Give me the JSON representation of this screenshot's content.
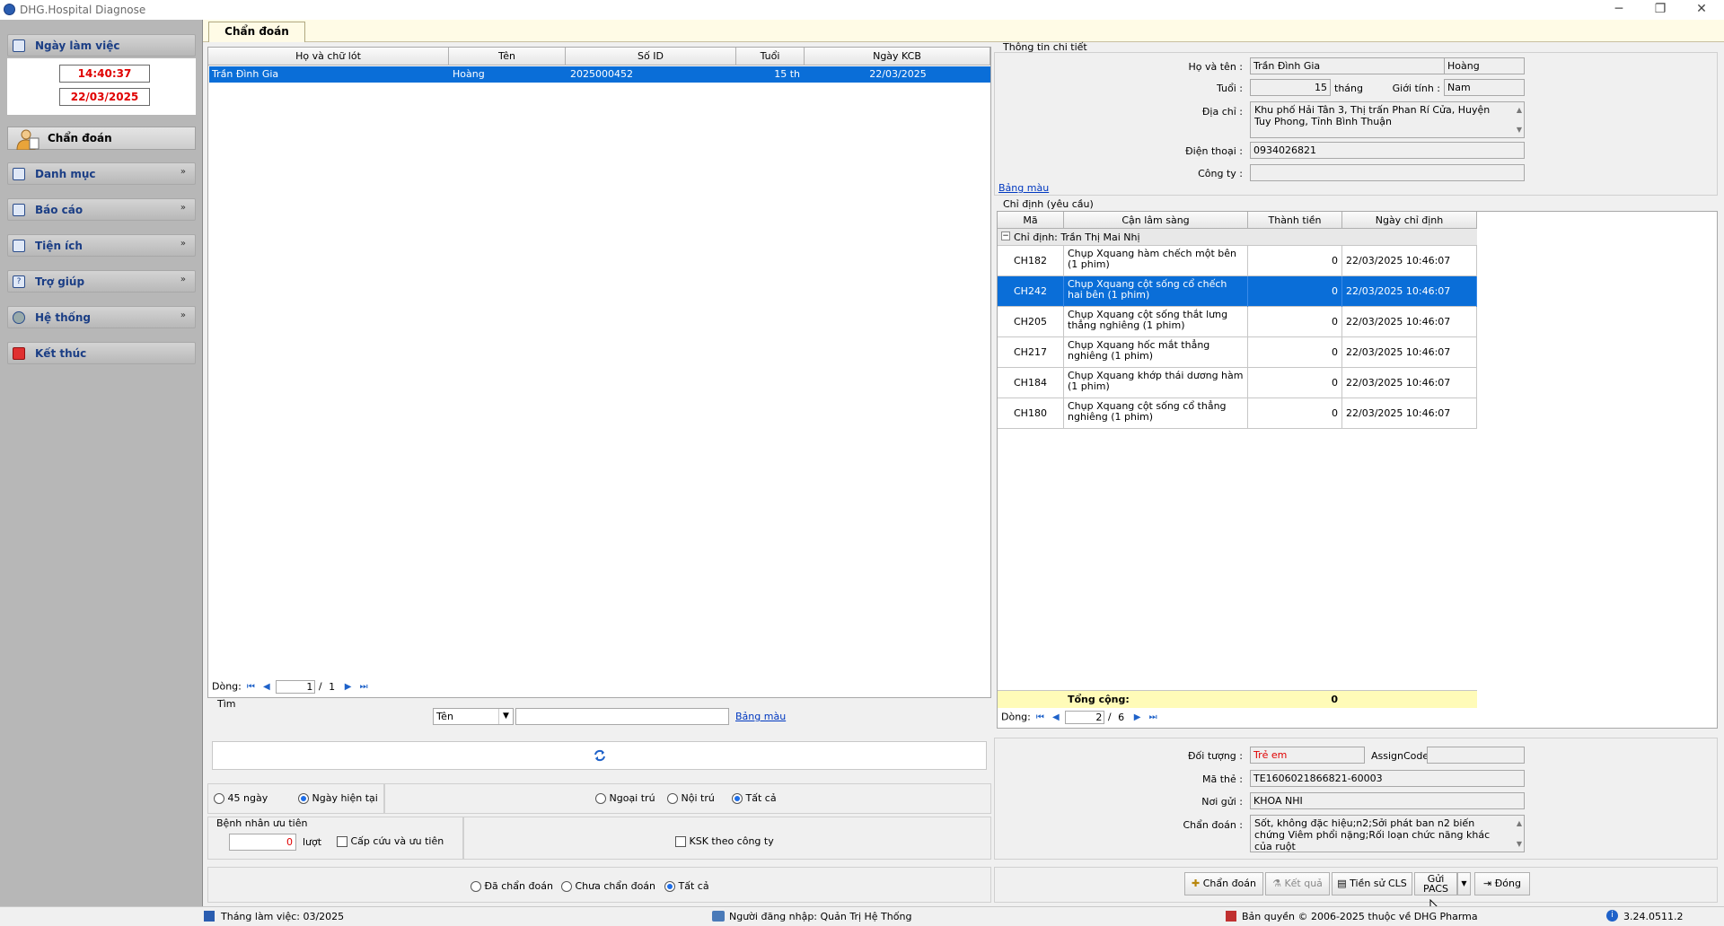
{
  "window": {
    "title": "DHG.Hospital Diagnose",
    "min": "─",
    "restore": "❐",
    "close": "✕"
  },
  "sidebar": {
    "work_day_label": "Ngày làm việc",
    "time": "14:40:37",
    "date": "22/03/2025",
    "active_item": "Chẩn đoán",
    "items": [
      {
        "label": "Danh mục",
        "chev": "»"
      },
      {
        "label": "Báo cáo",
        "chev": "»"
      },
      {
        "label": "Tiện ích",
        "chev": "»"
      },
      {
        "label": "Trợ giúp",
        "chev": "»"
      },
      {
        "label": "Hệ thống",
        "chev": "»"
      },
      {
        "label": "Kết thúc",
        "chev": ""
      }
    ]
  },
  "tab": {
    "label": "Chẩn đoán"
  },
  "patients": {
    "columns": [
      "Họ và chữ lót",
      "Tên",
      "Số ID",
      "Tuổi",
      "Ngày KCB"
    ],
    "rows": [
      [
        "Trần Đình Gia",
        "Hoàng",
        "2025000452",
        "15 th",
        "22/03/2025"
      ]
    ],
    "nav": {
      "label": "Dòng:",
      "page": "1",
      "sep": "/",
      "total": "1"
    }
  },
  "search": {
    "label": "Tìm",
    "field": "Tên",
    "value": "",
    "color_link": "Bảng màu"
  },
  "filters": {
    "days45": "45 ngày",
    "today": "Ngày hiện tại",
    "outpatient": "Ngoại trú",
    "inpatient": "Nội trú",
    "all": "Tất cả",
    "priority_group": "Bệnh nhân ưu tiên",
    "priority_count": "0",
    "visits": "lượt",
    "emergency": "Cấp cứu và ưu tiên",
    "ksk": "KSK theo công ty",
    "diagnosed": "Đã chẩn đoán",
    "not_diagnosed": "Chưa chẩn đoán",
    "all2": "Tất cả"
  },
  "detail": {
    "group_title": "Thông tin chi tiết",
    "name_label": "Họ và tên :",
    "surname": "Trần Đình Gia",
    "firstname": "Hoàng",
    "age_label": "Tuổi :",
    "age": "15",
    "age_unit": "tháng",
    "gender_label": "Giới tính :",
    "gender": "Nam",
    "address_label": "Địa chỉ :",
    "address": "Khu phố Hải Tân 3, Thị trấn Phan Rí Cửa, Huyện Tuy Phong, Tỉnh Bình Thuận",
    "phone_label": "Điện thoại :",
    "phone": "0934026821",
    "company_label": "Công ty :",
    "company": "",
    "color_link": "Bảng màu"
  },
  "orders": {
    "group_title": "Chỉ định (yêu cầu)",
    "columns": [
      "Mã",
      "Cận lâm sàng",
      "Thành tiền",
      "Ngày chỉ định"
    ],
    "group_row": "Chỉ định:  Trần Thị Mai Nhị",
    "rows": [
      {
        "code": "CH182",
        "name": "Chụp Xquang hàm chếch một bên (1 phim)",
        "amount": "0",
        "date": "22/03/2025 10:46:07"
      },
      {
        "code": "CH242",
        "name": "Chụp Xquang cột sống cổ chếch hai bên (1 phim)",
        "amount": "0",
        "date": "22/03/2025 10:46:07"
      },
      {
        "code": "CH205",
        "name": "Chụp Xquang cột sống thắt lưng thẳng nghiêng (1 phim)",
        "amount": "0",
        "date": "22/03/2025 10:46:07"
      },
      {
        "code": "CH217",
        "name": "Chụp Xquang hốc mắt thẳng nghiêng (1 phim)",
        "amount": "0",
        "date": "22/03/2025 10:46:07"
      },
      {
        "code": "CH184",
        "name": "Chụp Xquang khớp thái dương hàm (1 phim)",
        "amount": "0",
        "date": "22/03/2025 10:46:07"
      },
      {
        "code": "CH180",
        "name": "Chụp Xquang cột sống cổ thẳng nghiêng (1 phim)",
        "amount": "0",
        "date": "22/03/2025 10:46:07"
      }
    ],
    "selected_index": 1,
    "total_label": "Tổng cộng:",
    "total": "0",
    "nav": {
      "label": "Dòng:",
      "page": "2",
      "sep": "/",
      "total": "6"
    }
  },
  "extra": {
    "object_label": "Đối tượng :",
    "object": "Trẻ em",
    "assign_label": "AssignCode",
    "assign": "",
    "card_label": "Mã thẻ :",
    "card": "TE1606021866821-60003",
    "sender_label": "Nơi gửi :",
    "sender": "KHOA NHI",
    "diag_label": "Chẩn đoán :",
    "diag": "Sốt, không đặc hiệu;n2;Sởi phát ban n2 biến chứng Viêm phổi nặng;Rối loạn chức năng khác của ruột"
  },
  "buttons": {
    "diagnose": "Chẩn đoán",
    "result": "Kết quả",
    "history": "Tiền sử CLS",
    "pacs_1": "Gửi",
    "pacs_2": "PACS",
    "close": "Đóng"
  },
  "status": {
    "month": "Tháng làm việc: 03/2025",
    "user": "Người đăng nhập: Quản Trị Hệ Thống",
    "copyright": "Bản quyền © 2006-2025 thuộc về DHG Pharma",
    "version": "3.24.0511.2"
  },
  "colors": {
    "selection": "#0a6ed8",
    "date_red": "#e00000",
    "link": "#0038c0",
    "total_bg": "#fffbb8"
  }
}
